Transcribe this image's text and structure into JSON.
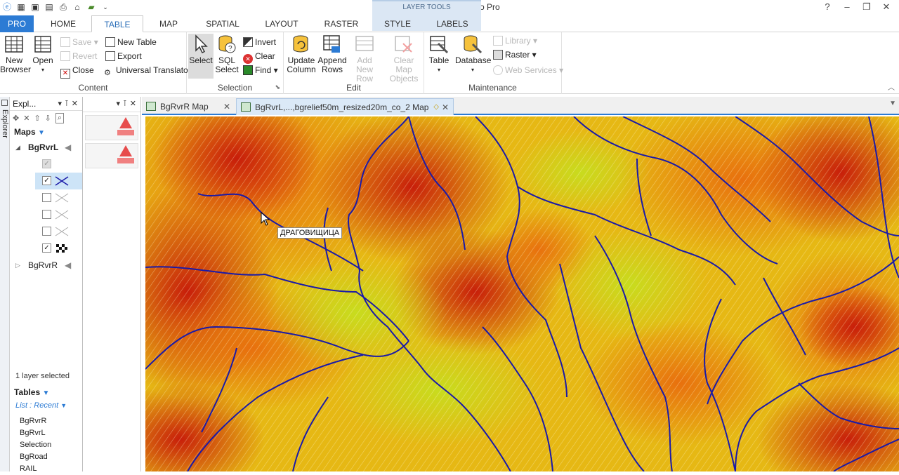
{
  "window": {
    "title": "*demo.WOR - MapInfo Pro",
    "help": "?",
    "min": "–",
    "restore": "❐",
    "close": "✕"
  },
  "context_group": "LAYER TOOLS",
  "tabs": [
    "PRO",
    "HOME",
    "TABLE",
    "MAP",
    "SPATIAL",
    "LAYOUT",
    "RASTER",
    "STYLE",
    "LABELS"
  ],
  "ribbon": {
    "content": {
      "label": "Content",
      "new_browser": "New Browser",
      "open": "Open",
      "save": "Save",
      "revert": "Revert",
      "close": "Close",
      "new_table": "New Table",
      "export": "Export",
      "universal_translator": "Universal Translator"
    },
    "selection": {
      "label": "Selection",
      "select": "Select",
      "sql_select": "SQL Select",
      "invert": "Invert",
      "clear": "Clear",
      "find": "Find"
    },
    "edit": {
      "label": "Edit",
      "update_column": "Update Column",
      "append_rows": "Append Rows",
      "add_new_row": "Add New Row",
      "clear_map_objects": "Clear Map Objects"
    },
    "maintenance": {
      "label": "Maintenance",
      "table": "Table",
      "database": "Database",
      "library": "Library",
      "raster": "Raster",
      "web_services": "Web Services"
    }
  },
  "side_strip": "Explorer",
  "explorer": {
    "title": "Expl...",
    "maps_label": "Maps",
    "map1": "BgRvrL",
    "map2": "BgRvrR",
    "layer_checks": [
      true,
      true,
      false,
      false,
      false,
      true
    ],
    "status": "1 layer selected",
    "tables_label": "Tables",
    "list_mode": "List : Recent",
    "tables": [
      "BgRvrR",
      "BgRvrL",
      "Selection",
      "BgRoad",
      "RAIL"
    ]
  },
  "doc_tabs": [
    {
      "label": "BgRvrR Map",
      "active": false
    },
    {
      "label": "BgRvrL,...,bgrelief50m_resized20m_co_2 Map",
      "active": true
    }
  ],
  "map": {
    "label": "ДРАГОВИЩИЦА",
    "river_color": "#1a1aa8"
  }
}
